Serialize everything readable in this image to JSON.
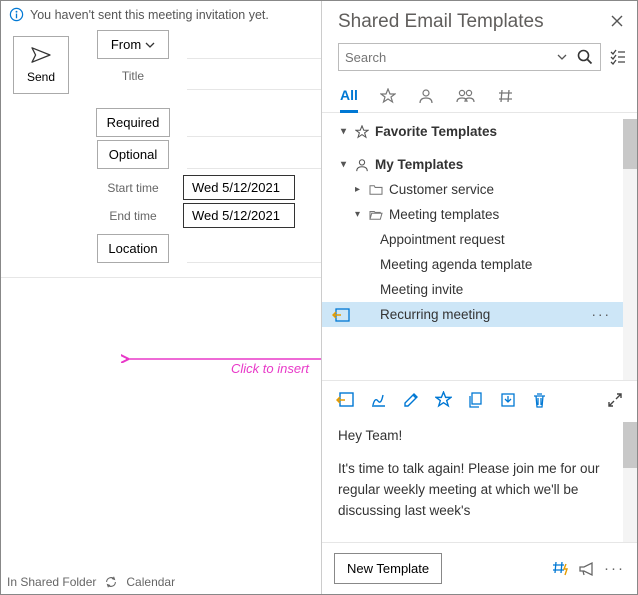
{
  "info_bar": {
    "message": "You haven't sent this meeting invitation yet."
  },
  "compose": {
    "send": "Send",
    "from": "From",
    "title": "Title",
    "required": "Required",
    "optional": "Optional",
    "start_time": "Start time",
    "end_time": "End time",
    "start_value": "Wed 5/12/2021",
    "end_value": "Wed 5/12/2021",
    "location": "Location"
  },
  "status": {
    "folder": "In Shared Folder",
    "view": "Calendar"
  },
  "annotation": {
    "text": "Click to insert"
  },
  "panel": {
    "title": "Shared Email Templates",
    "search_placeholder": "Search",
    "tabs": {
      "all": "All"
    },
    "tree": {
      "favorites": "Favorite Templates",
      "my_templates": "My Templates",
      "customer_service": "Customer service",
      "meeting_templates": "Meeting templates",
      "items": {
        "appointment": "Appointment request",
        "agenda": "Meeting agenda template",
        "invite": "Meeting invite",
        "recurring": "Recurring meeting"
      }
    },
    "preview": {
      "greeting": "Hey Team!",
      "body": "It's time to talk again! Please join me for our regular weekly meeting at which we'll be discussing last week's"
    },
    "new_template": "New Template"
  }
}
